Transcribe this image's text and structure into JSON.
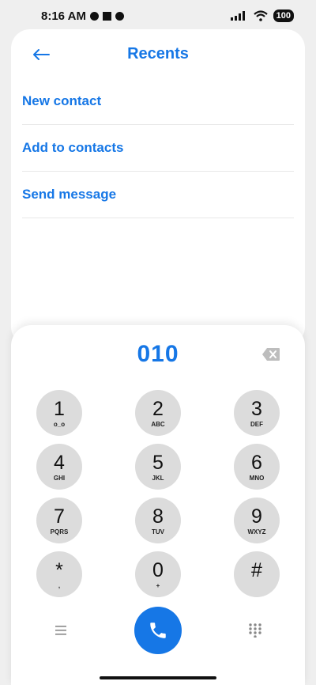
{
  "status_bar": {
    "time": "8:16 AM",
    "battery": "100"
  },
  "header": {
    "title": "Recents"
  },
  "menu": {
    "items": [
      {
        "label": "New contact"
      },
      {
        "label": "Add to contacts"
      },
      {
        "label": "Send message"
      }
    ]
  },
  "dialer": {
    "number": "010",
    "keys": [
      {
        "digit": "1",
        "letters": "o_o"
      },
      {
        "digit": "2",
        "letters": "ABC"
      },
      {
        "digit": "3",
        "letters": "DEF"
      },
      {
        "digit": "4",
        "letters": "GHI"
      },
      {
        "digit": "5",
        "letters": "JKL"
      },
      {
        "digit": "6",
        "letters": "MNO"
      },
      {
        "digit": "7",
        "letters": "PQRS"
      },
      {
        "digit": "8",
        "letters": "TUV"
      },
      {
        "digit": "9",
        "letters": "WXYZ"
      },
      {
        "digit": "*",
        "letters": ","
      },
      {
        "digit": "0",
        "letters": "+"
      },
      {
        "digit": "#",
        "letters": ""
      }
    ]
  },
  "colors": {
    "accent": "#1677e6",
    "key_bg": "#dcdcdc"
  },
  "icons": [
    "back-arrow-icon",
    "backspace-icon",
    "menu-list-icon",
    "phone-icon",
    "dialpad-icon",
    "wifi-icon",
    "signal-icon",
    "battery-icon"
  ]
}
